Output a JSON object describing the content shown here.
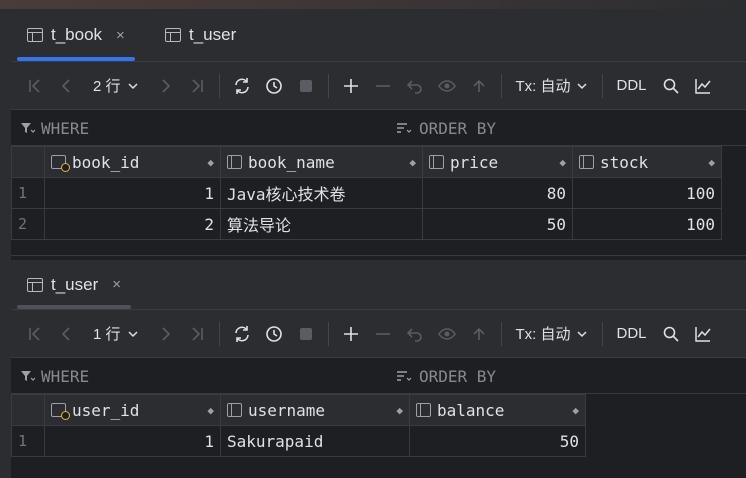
{
  "book_panel": {
    "tabs": [
      {
        "label": "t_book",
        "close": "×"
      },
      {
        "label": "t_user"
      }
    ],
    "toolbar": {
      "rows": "2 行",
      "tx": "Tx: 自动",
      "ddl": "DDL"
    },
    "filter": {
      "where": "WHERE",
      "order_by": "ORDER BY"
    },
    "columns": [
      "book_id",
      "book_name",
      "price",
      "stock"
    ],
    "rows": [
      {
        "num": "1",
        "book_id": "1",
        "book_name": "Java核心技术卷",
        "price": "80",
        "stock": "100"
      },
      {
        "num": "2",
        "book_id": "2",
        "book_name": "算法导论",
        "price": "50",
        "stock": "100"
      }
    ]
  },
  "user_panel": {
    "tabs": [
      {
        "label": "t_user",
        "close": "×"
      }
    ],
    "toolbar": {
      "rows": "1 行",
      "tx": "Tx: 自动",
      "ddl": "DDL"
    },
    "filter": {
      "where": "WHERE",
      "order_by": "ORDER BY"
    },
    "columns": [
      "user_id",
      "username",
      "balance"
    ],
    "rows": [
      {
        "num": "1",
        "user_id": "1",
        "username": "Sakurapaid",
        "balance": "50"
      }
    ]
  },
  "colors": {
    "accent": "#3574f0",
    "bg": "#1e1f22",
    "panel": "#2b2d30",
    "key": "#e2b53e"
  }
}
